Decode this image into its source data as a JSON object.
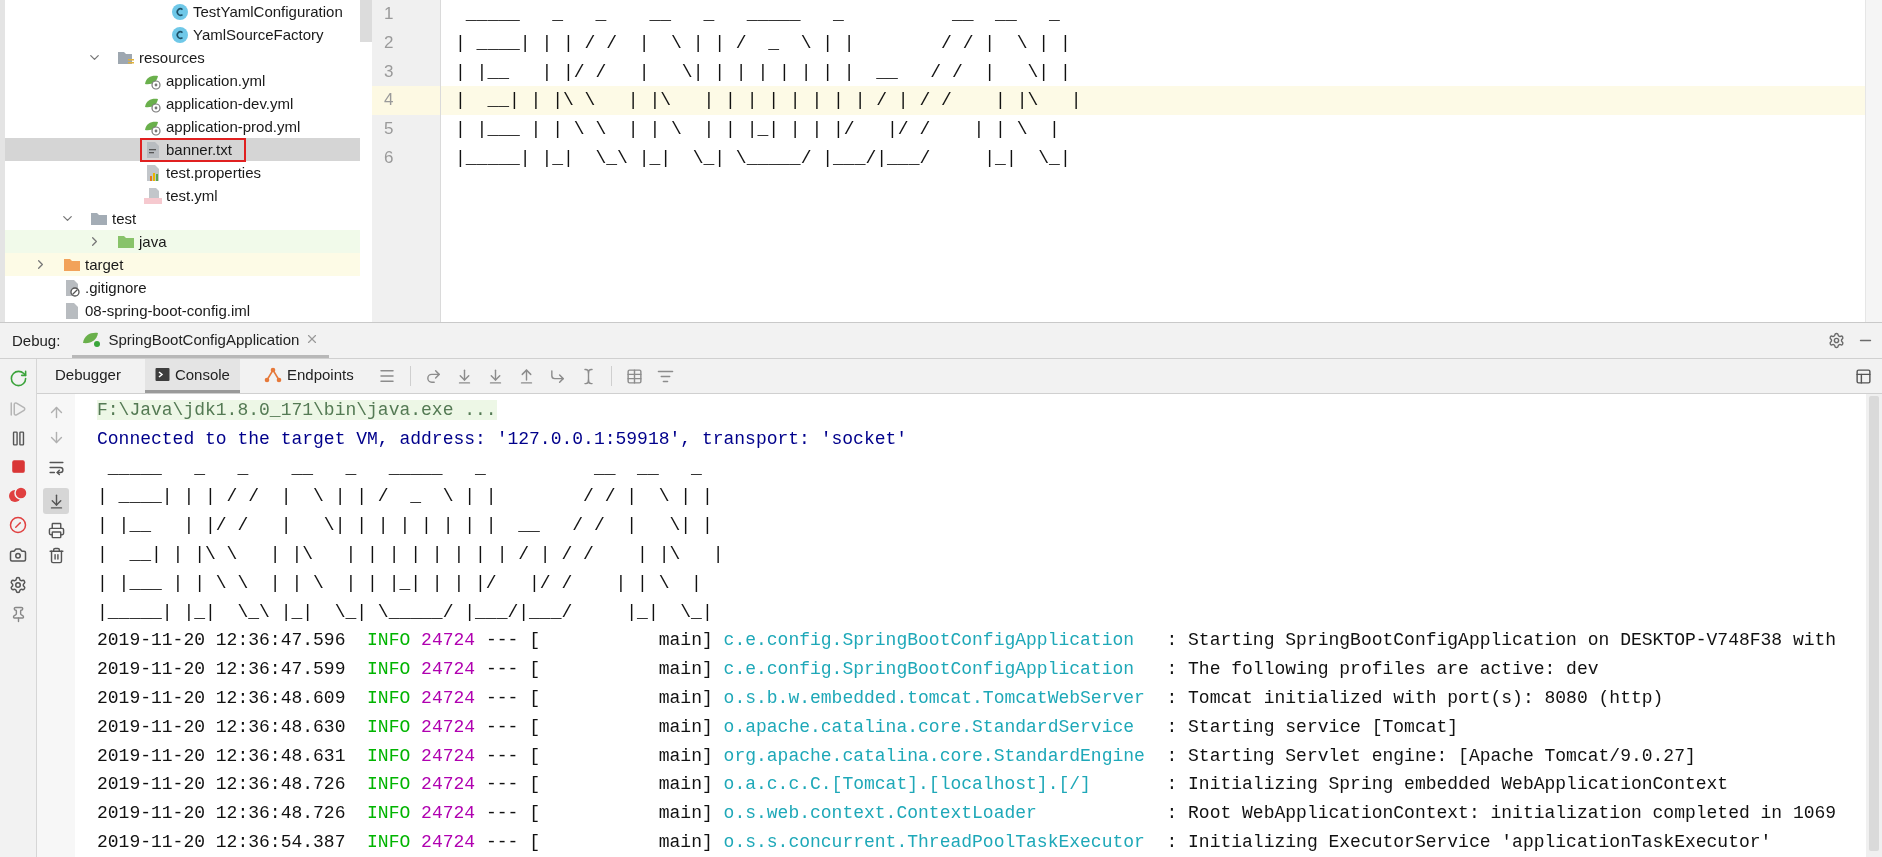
{
  "project_tree": [
    {
      "children": [
        {
          "children": [
            {
              "children": [
                {
                  "children": [
                    {
                      "label": "TestYamlConfiguration",
                      "kind": "class",
                      "selected": false,
                      "marked": false
                    },
                    {
                      "label": "YamlSourceFactory",
                      "kind": "class",
                      "selected": false,
                      "marked": false
                    }
                  ]
                }
              ]
            },
            {
              "label": "resources",
              "kind": "resources-folder",
              "expanded": true,
              "selected": false,
              "marked": false,
              "children": [
                {
                  "label": "application.yml",
                  "kind": "spring-config",
                  "selected": false,
                  "marked": false
                },
                {
                  "label": "application-dev.yml",
                  "kind": "spring-config",
                  "selected": false,
                  "marked": false
                },
                {
                  "label": "application-prod.yml",
                  "kind": "spring-config",
                  "selected": false,
                  "marked": false
                },
                {
                  "label": "banner.txt",
                  "kind": "text",
                  "selected": true,
                  "marked": true
                },
                {
                  "label": "test.properties",
                  "kind": "properties",
                  "selected": false,
                  "marked": false
                },
                {
                  "label": "test.yml",
                  "kind": "yml",
                  "selected": false,
                  "marked": false
                }
              ]
            }
          ]
        },
        {
          "label": "test",
          "kind": "folder",
          "expanded": true,
          "selected": false,
          "marked": false,
          "children": [
            {
              "label": "java",
              "kind": "test-folder",
              "expanded": false,
              "selected": false,
              "marked": false
            }
          ]
        }
      ]
    },
    {
      "label": "target",
      "kind": "excluded-folder",
      "expanded": false,
      "selected": false,
      "marked": false
    },
    {
      "label": ".gitignore",
      "kind": "ignore-file",
      "selected": false,
      "marked": false
    },
    {
      "label": "08-spring-boot-config.iml",
      "kind": "module-file",
      "selected": false,
      "marked": false
    }
  ],
  "editor": {
    "lines": [
      {
        "number": "1",
        "text": " _____   _   _    __   _   _____   _          __  __   _",
        "current": false
      },
      {
        "number": "2",
        "text": "| ____| | | / /  |  \\ | | /  _  \\ | |        / / |  \\ | |",
        "current": false
      },
      {
        "number": "3",
        "text": "| |__   | |/ /   |   \\| | | | | | | |  __   / /  |   \\| |",
        "current": false
      },
      {
        "number": "4",
        "text": "|  __| | |\\ \\   | |\\   | | | | | | | | / | / /    | |\\   |",
        "current": true
      },
      {
        "number": "5",
        "text": "| |___ | | \\ \\  | | \\  | | |_| | | |/   |/ /    | | \\  |",
        "current": false
      },
      {
        "number": "6",
        "text": "|_____| |_|  \\_\\ |_|  \\_| \\_____/ |___/|___/     |_|  \\_|",
        "current": false
      }
    ]
  },
  "debug": {
    "label": "Debug:",
    "session": "SpringBootConfigApplication",
    "tabs": [
      {
        "label": "Debugger",
        "kind": "debugger",
        "selected": false
      },
      {
        "label": "Console",
        "kind": "console",
        "selected": true
      },
      {
        "label": "Endpoints",
        "kind": "endpoints",
        "selected": false
      }
    ],
    "soft_wrap": false,
    "scroll_to_end": true
  },
  "console": {
    "lines": [
      {
        "kind": "command",
        "text": "F:\\Java\\jdk1.8.0_171\\bin\\java.exe ..."
      },
      {
        "kind": "system",
        "text": "Connected to the target VM, address: '127.0.0.1:59918', transport: 'socket'"
      }
    ],
    "banner": [
      " _____   _   _    __   _   _____   _          __  __   _",
      "| ____| | | / /  |  \\ | | /  _  \\ | |        / / |  \\ | |",
      "| |__   | |/ /   |   \\| | | | | | | |  __   / /  |   \\| |",
      "|  __| | |\\ \\   | |\\   | | | | | | | | / | / /    | |\\   |",
      "| |___ | | \\ \\  | | \\  | | |_| | | |/   |/ /    | | \\  |",
      "|_____| |_|  \\_\\ |_|  \\_| \\_____/ |___/|___/     |_|  \\_|"
    ],
    "log": [
      {
        "timestamp": "2019-11-20 12:36:47.596",
        "severity": "INFO",
        "pid": "24724",
        "separator": "---",
        "thread": "[           main]",
        "logger": "c.e.config.SpringBootConfigApplication",
        "message": ": Starting SpringBootConfigApplication on DESKTOP-V748F38 with"
      },
      {
        "timestamp": "2019-11-20 12:36:47.599",
        "severity": "INFO",
        "pid": "24724",
        "separator": "---",
        "thread": "[           main]",
        "logger": "c.e.config.SpringBootConfigApplication",
        "message": ": The following profiles are active: dev"
      },
      {
        "timestamp": "2019-11-20 12:36:48.609",
        "severity": "INFO",
        "pid": "24724",
        "separator": "---",
        "thread": "[           main]",
        "logger": "o.s.b.w.embedded.tomcat.TomcatWebServer",
        "message": ": Tomcat initialized with port(s): 8080 (http)"
      },
      {
        "timestamp": "2019-11-20 12:36:48.630",
        "severity": "INFO",
        "pid": "24724",
        "separator": "---",
        "thread": "[           main]",
        "logger": "o.apache.catalina.core.StandardService",
        "message": ": Starting service [Tomcat]"
      },
      {
        "timestamp": "2019-11-20 12:36:48.631",
        "severity": "INFO",
        "pid": "24724",
        "separator": "---",
        "thread": "[           main]",
        "logger": "org.apache.catalina.core.StandardEngine",
        "message": ": Starting Servlet engine: [Apache Tomcat/9.0.27]"
      },
      {
        "timestamp": "2019-11-20 12:36:48.726",
        "severity": "INFO",
        "pid": "24724",
        "separator": "---",
        "thread": "[           main]",
        "logger": "o.a.c.c.C.[Tomcat].[localhost].[/]",
        "message": ": Initializing Spring embedded WebApplicationContext"
      },
      {
        "timestamp": "2019-11-20 12:36:48.726",
        "severity": "INFO",
        "pid": "24724",
        "separator": "---",
        "thread": "[           main]",
        "logger": "o.s.web.context.ContextLoader",
        "message": ": Root WebApplicationContext: initialization completed in 1069"
      },
      {
        "timestamp": "2019-11-20 12:36:54.387",
        "severity": "INFO",
        "pid": "24724",
        "separator": "---",
        "thread": "[           main]",
        "logger": "o.s.s.concurrent.ThreadPoolTaskExecutor",
        "message": ": Initializing ExecutorService 'applicationTaskExecutor'"
      }
    ]
  }
}
